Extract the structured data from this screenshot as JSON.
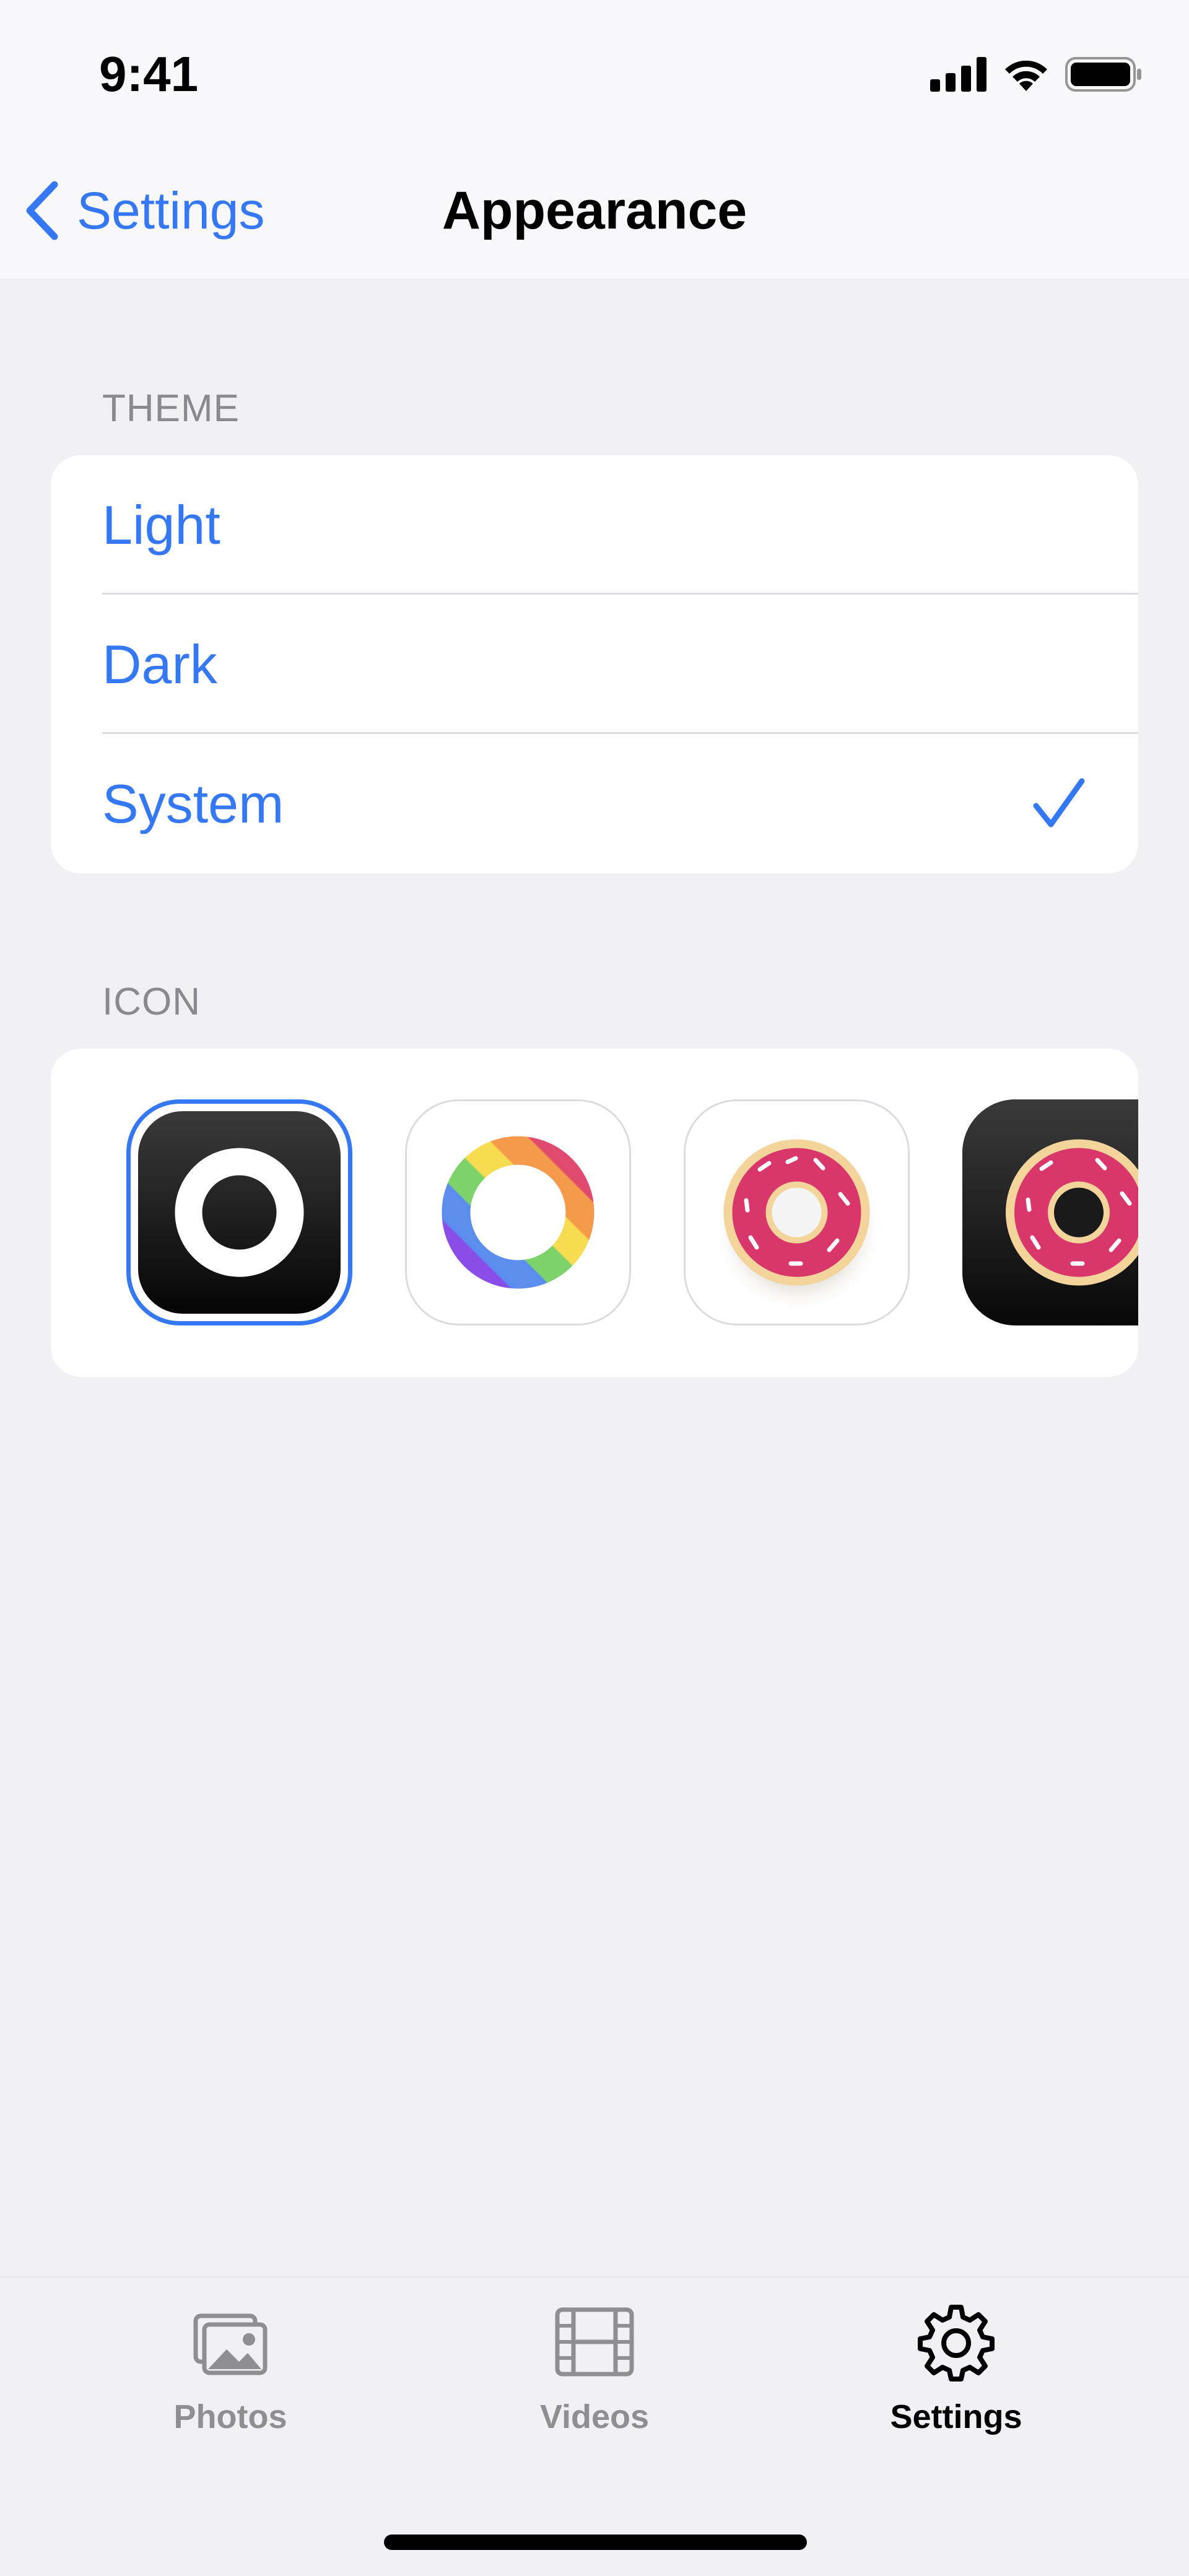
{
  "status_bar": {
    "time": "9:41",
    "icons": [
      "cellular-signal-icon",
      "wifi-icon",
      "battery-icon"
    ]
  },
  "nav": {
    "back_label": "Settings",
    "title": "Appearance"
  },
  "theme_section": {
    "header": "THEME",
    "options": [
      {
        "label": "Light",
        "selected": false
      },
      {
        "label": "Dark",
        "selected": false
      },
      {
        "label": "System",
        "selected": true
      }
    ]
  },
  "icon_section": {
    "header": "ICON",
    "options": [
      {
        "icon": "black-ring-app-icon",
        "selected": true
      },
      {
        "icon": "rainbow-ring-app-icon",
        "selected": false
      },
      {
        "icon": "pink-donut-light-app-icon",
        "selected": false
      },
      {
        "icon": "pink-donut-dark-app-icon",
        "selected": false
      }
    ]
  },
  "tab_bar": {
    "tabs": [
      {
        "label": "Photos",
        "icon": "photos-icon",
        "active": false
      },
      {
        "label": "Videos",
        "icon": "film-icon",
        "active": false
      },
      {
        "label": "Settings",
        "icon": "gear-icon",
        "active": true
      }
    ]
  },
  "colors": {
    "accent": "#3478f6",
    "background": "#f0f0f5",
    "card": "#ffffff",
    "secondary_text": "#8a8a8e",
    "inactive_tab": "#8e8e93"
  }
}
